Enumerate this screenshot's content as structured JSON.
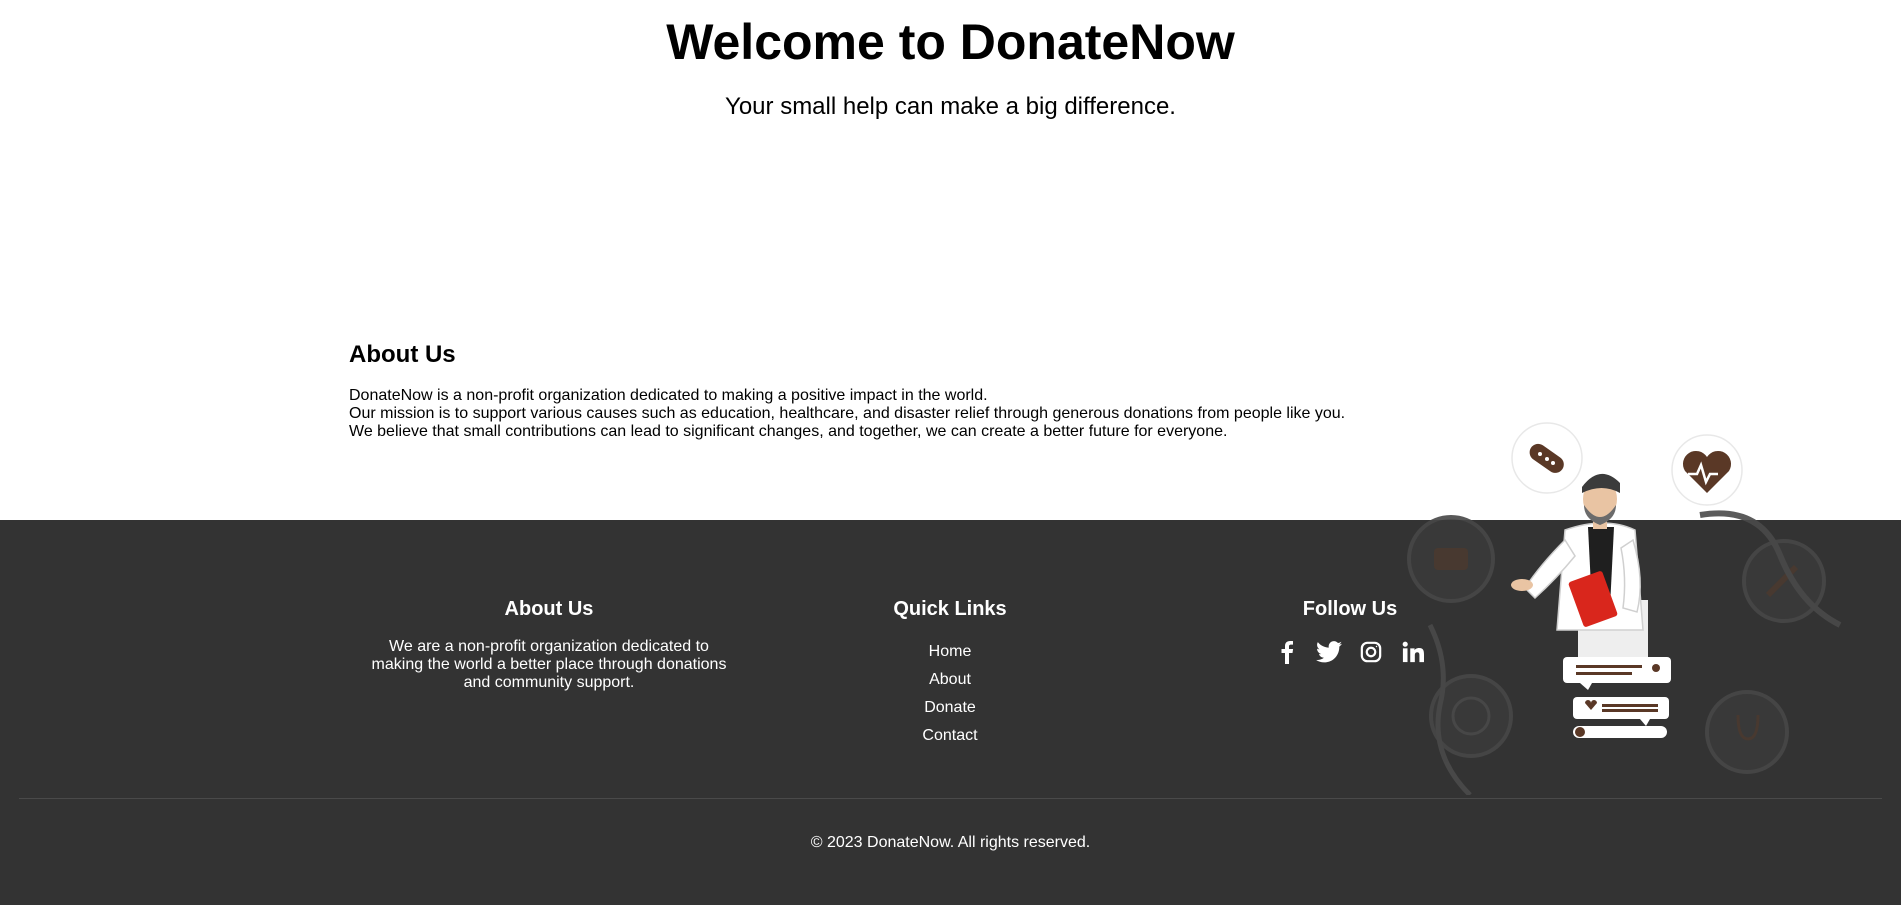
{
  "hero": {
    "title": "Welcome to DonateNow",
    "subtitle": "Your small help can make a big difference."
  },
  "about": {
    "heading": "About Us",
    "lines": [
      "DonateNow is a non-profit organization dedicated to making a positive impact in the world.",
      "Our mission is to support various causes such as education, healthcare, and disaster relief through generous donations from people like you.",
      "We believe that small contributions can lead to significant changes, and together, we can create a better future for everyone."
    ]
  },
  "footer": {
    "about": {
      "heading": "About Us",
      "text": "We are a non-profit organization dedicated to making the world a better place through donations and community support."
    },
    "quick_links": {
      "heading": "Quick Links",
      "items": [
        "Home",
        "About",
        "Donate",
        "Contact"
      ]
    },
    "follow": {
      "heading": "Follow Us",
      "icons": [
        "facebook-icon",
        "twitter-icon",
        "instagram-icon",
        "linkedin-icon"
      ]
    },
    "copyright": "© 2023 DonateNow. All rights reserved."
  },
  "colors": {
    "footer_bg": "#333333",
    "footer_text": "#ffffff",
    "illustration_brown": "#5a3826",
    "illustration_red": "#d9261c"
  }
}
